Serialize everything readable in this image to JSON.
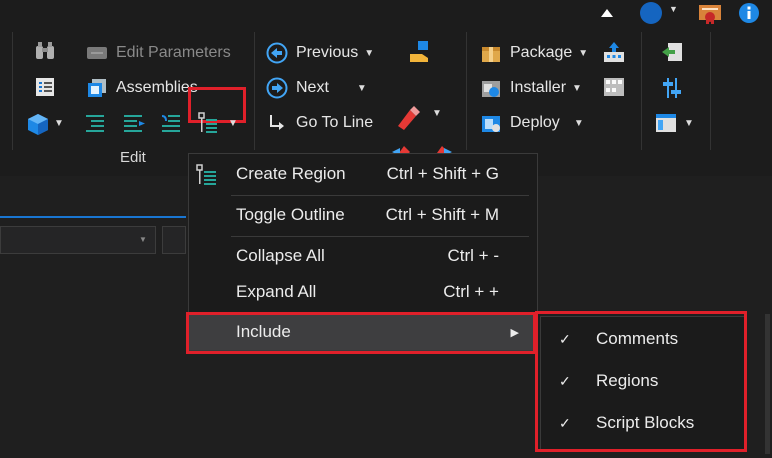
{
  "ribbon": {
    "edit_parameters": "Edit Parameters",
    "assemblies": "Assemblies",
    "previous": "Previous",
    "next": "Next",
    "go_to_line": "Go To Line",
    "package": "Package",
    "installer": "Installer",
    "deploy": "Deploy",
    "edit_group": "Edit"
  },
  "menu": {
    "items": [
      {
        "label": "Create Region",
        "shortcut": "Ctrl + Shift + G"
      },
      {
        "label": "Toggle Outline",
        "shortcut": "Ctrl + Shift + M"
      },
      {
        "label": "Collapse All",
        "shortcut": "Ctrl + -"
      },
      {
        "label": "Expand All",
        "shortcut": "Ctrl + +"
      },
      {
        "label": "Include",
        "arrow": "▶"
      }
    ]
  },
  "submenu": {
    "items": [
      {
        "check": "✓",
        "label": "Comments"
      },
      {
        "check": "✓",
        "label": "Regions"
      },
      {
        "check": "✓",
        "label": "Script Blocks"
      }
    ]
  },
  "colors": {
    "highlight_red": "#e0202a",
    "accent_blue": "#1976d2",
    "menu_hover": "#3e3e40"
  }
}
